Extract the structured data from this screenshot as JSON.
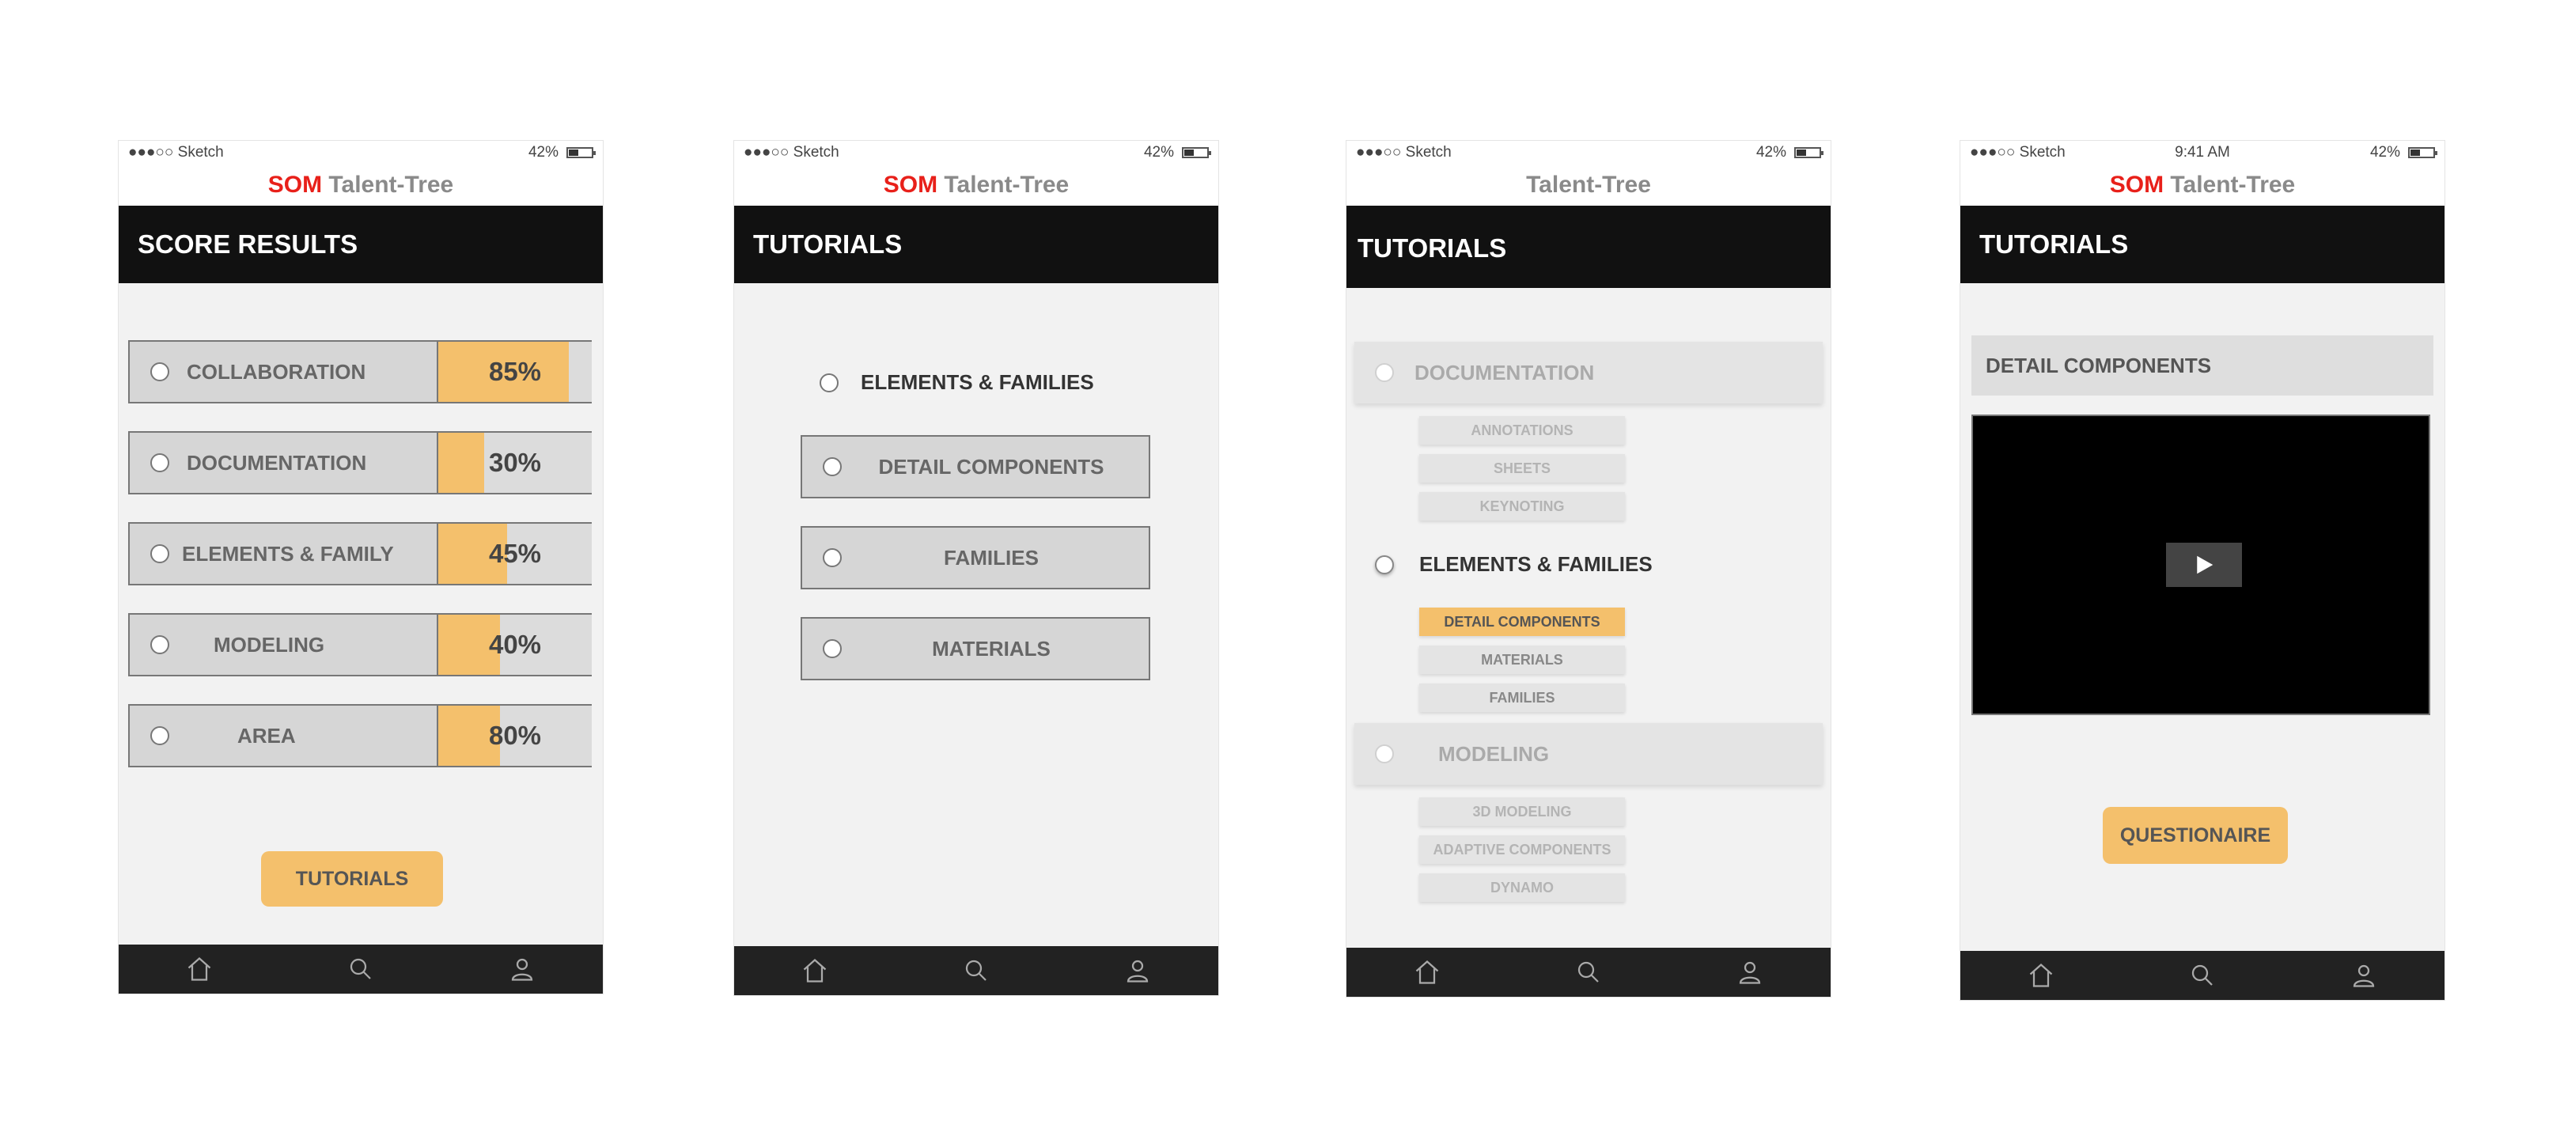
{
  "status": {
    "carrier": "●●●○○ Sketch",
    "battery": "42%",
    "time": "9:41 AM"
  },
  "brand": {
    "som": "SOM",
    "talent_tree": "Talent-Tree"
  },
  "screen1": {
    "title": "SCORE RESULTS",
    "rows": [
      {
        "label": "COLLABORATION",
        "percent": "85%",
        "fill": 0.85
      },
      {
        "label": "DOCUMENTATION",
        "percent": "30%",
        "fill": 0.3
      },
      {
        "label": "ELEMENTS & FAMILY",
        "percent": "45%",
        "fill": 0.45
      },
      {
        "label": "MODELING",
        "percent": "40%",
        "fill": 0.4
      },
      {
        "label": "AREA",
        "percent": "80%",
        "fill": 0.4
      }
    ],
    "button": "TUTORIALS"
  },
  "screen2": {
    "title": "TUTORIALS",
    "heading": "ELEMENTS & FAMILIES",
    "items": [
      "DETAIL COMPONENTS",
      "FAMILIES",
      "MATERIALS"
    ]
  },
  "screen3": {
    "title": "TUTORIALS",
    "sections": [
      {
        "label": "DOCUMENTATION",
        "items": [
          "ANNOTATIONS",
          "SHEETS",
          "KEYNOTING"
        ]
      },
      {
        "label": "ELEMENTS & FAMILIES",
        "items": [
          "DETAIL COMPONENTS",
          "MATERIALS",
          "FAMILIES"
        ]
      },
      {
        "label": "MODELING",
        "items": [
          "3D MODELING",
          "ADAPTIVE COMPONENTS",
          "DYNAMO"
        ]
      }
    ]
  },
  "screen4": {
    "title": "TUTORIALS",
    "section": "DETAIL COMPONENTS",
    "button": "QUESTIONAIRE"
  },
  "colors": {
    "accent": "#f4c06c",
    "brand_red": "#e8201a",
    "header": "#111111"
  },
  "tab_icons": [
    "home-icon",
    "search-icon",
    "user-icon"
  ]
}
